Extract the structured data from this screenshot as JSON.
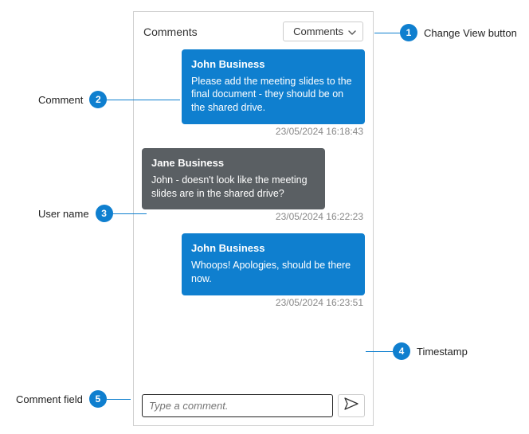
{
  "panel": {
    "title": "Comments",
    "view_button_label": "Comments"
  },
  "messages": [
    {
      "author": "John Business",
      "body": "Please add the meeting slides to the final document - they should be on the shared drive.",
      "timestamp": "23/05/2024 16:18:43",
      "side": "right",
      "color": "blue"
    },
    {
      "author": "Jane Business",
      "body": "John - doesn't look like the meeting slides are in the shared drive?",
      "timestamp": "23/05/2024 16:22:23",
      "side": "left",
      "color": "grey"
    },
    {
      "author": "John Business",
      "body": "Whoops! Apologies, should be there now.",
      "timestamp": "23/05/2024 16:23:51",
      "side": "right",
      "color": "blue"
    }
  ],
  "composer": {
    "placeholder": "Type a comment."
  },
  "callouts": [
    {
      "n": "1",
      "label": "Change View button"
    },
    {
      "n": "2",
      "label": "Comment"
    },
    {
      "n": "3",
      "label": "User name"
    },
    {
      "n": "4",
      "label": "Timestamp"
    },
    {
      "n": "5",
      "label": "Comment field"
    }
  ]
}
